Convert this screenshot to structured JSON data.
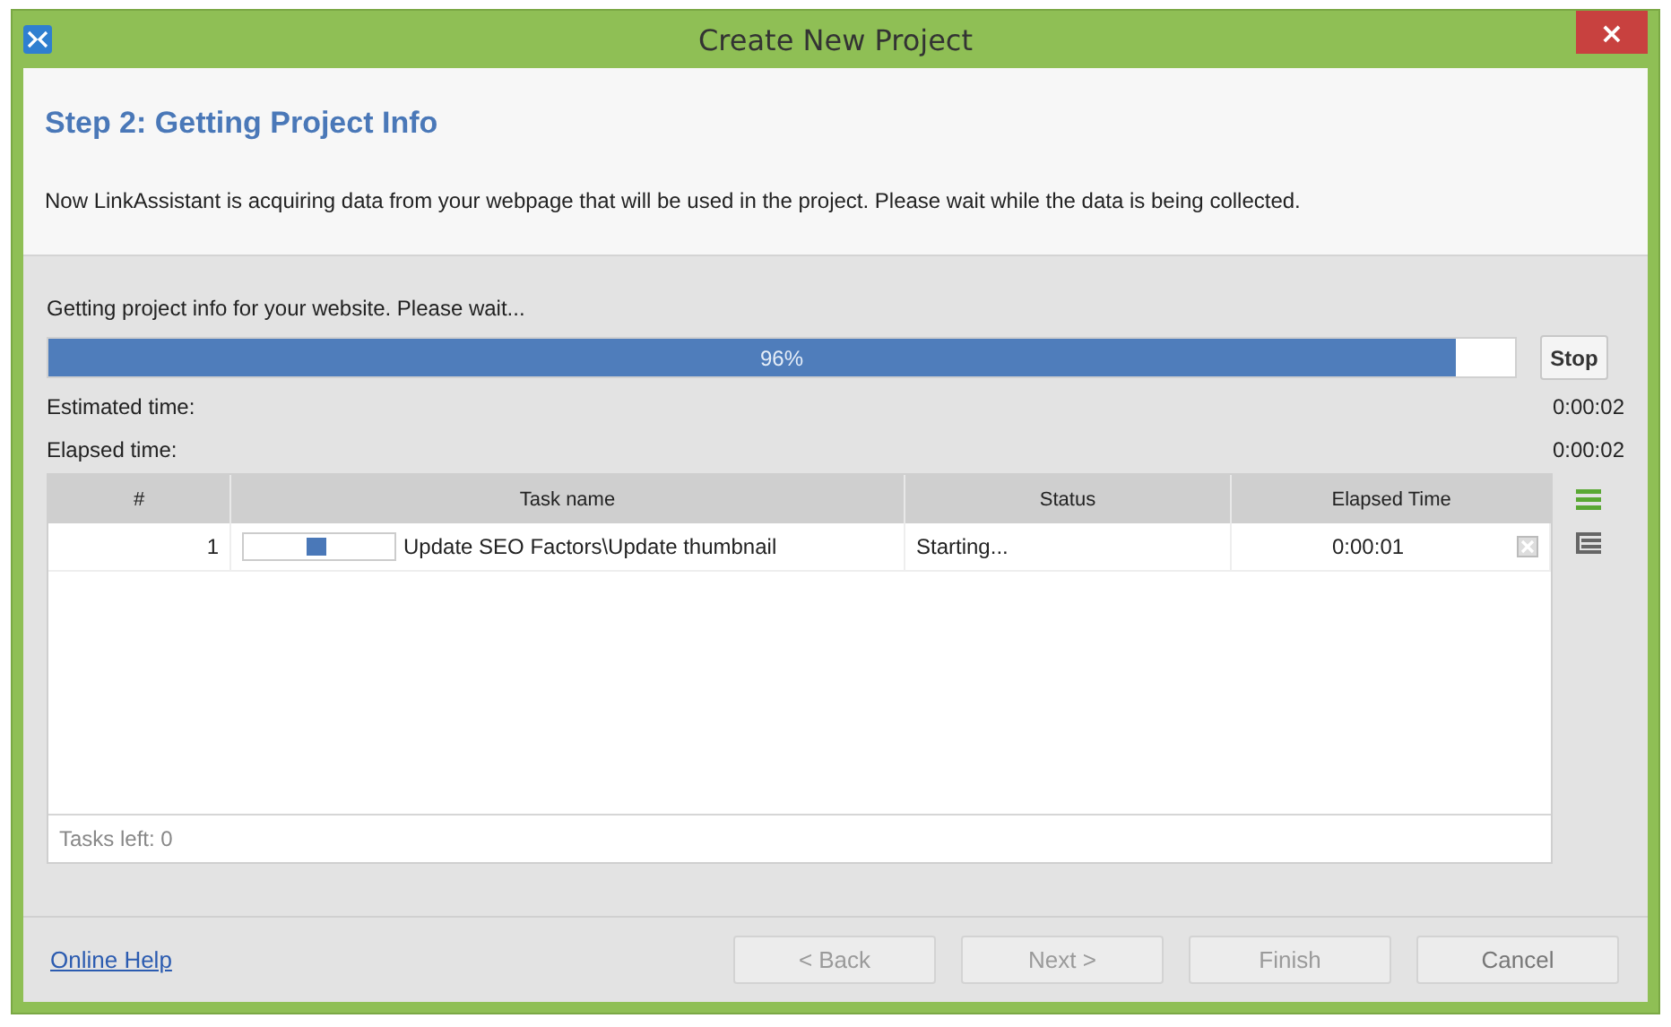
{
  "window": {
    "title": "Create New Project",
    "close": "×"
  },
  "header": {
    "step": "Step 2: Getting Project Info",
    "description": "Now LinkAssistant is acquiring data from your webpage that will be used in the project. Please wait while the data is being collected."
  },
  "progress": {
    "label": "Getting project info for your website. Please wait...",
    "level": 0.96,
    "reading": "96%",
    "stop": "Stop"
  },
  "times": [
    {
      "label": "Estimated time:",
      "value": "0:00:02"
    },
    {
      "label": "Elapsed time:",
      "value": "0:00:02"
    }
  ],
  "table": {
    "columns": [
      "#",
      "Task name",
      "Status",
      "Elapsed Time"
    ],
    "rows": [
      {
        "number": "1",
        "task": "Update SEO Factors\\Update thumbnail",
        "status": "Starting...",
        "elapsed": "0:00:01"
      }
    ],
    "footer": "Tasks left: 0"
  },
  "footer": {
    "help": "Online Help",
    "buttons": [
      {
        "label": "< Back",
        "disabled": true
      },
      {
        "label": "Next >",
        "disabled": true
      },
      {
        "label": "Finish",
        "disabled": true
      },
      {
        "label": "Cancel",
        "disabled": false
      }
    ]
  }
}
